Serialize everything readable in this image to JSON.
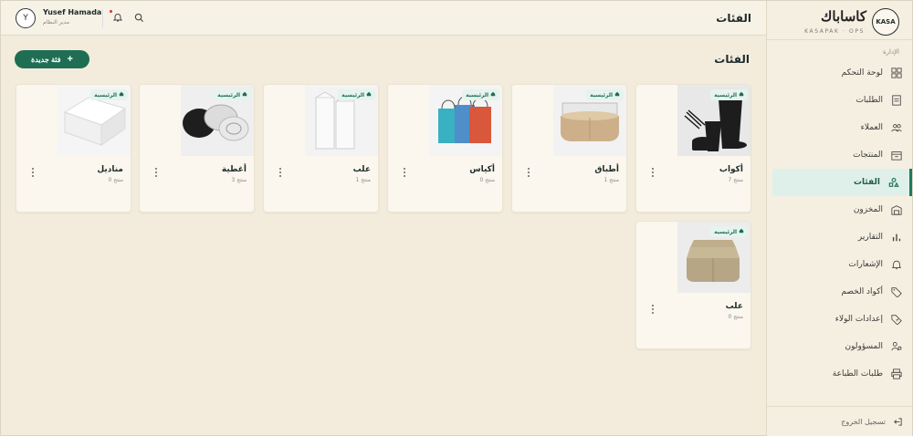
{
  "header": {
    "title": "الفئات",
    "user_name": "Yusef Hamada",
    "user_role": "مدير النظام",
    "avatar_initial": "Y"
  },
  "brand": {
    "badge": "KASA",
    "name_ar": "كاساباك",
    "name_en": "KASAPAK · OPS"
  },
  "sidebar": {
    "section_label": "الإدارة",
    "items": [
      {
        "label": "لوحة التحكم",
        "icon": "dashboard-icon"
      },
      {
        "label": "الطلبات",
        "icon": "orders-icon"
      },
      {
        "label": "العملاء",
        "icon": "customers-icon"
      },
      {
        "label": "المنتجات",
        "icon": "products-icon"
      },
      {
        "label": "الفئات",
        "icon": "categories-icon"
      },
      {
        "label": "المخزون",
        "icon": "warehouse-icon"
      },
      {
        "label": "التقارير",
        "icon": "reports-icon"
      },
      {
        "label": "الإشعارات",
        "icon": "bell-icon"
      },
      {
        "label": "أكواد الخصم",
        "icon": "tag-icon"
      },
      {
        "label": "إعدادات الولاء",
        "icon": "loyalty-icon"
      },
      {
        "label": "المسؤولون",
        "icon": "admins-icon"
      },
      {
        "label": "طلبات الطباعة",
        "icon": "printer-icon"
      }
    ],
    "active_index": 4,
    "logout_label": "تسجيل الخروج"
  },
  "main": {
    "title": "الفئات",
    "new_button": "فئة جديدة",
    "badge_label": "الرئيسية",
    "cards": [
      {
        "name": "أكواب",
        "count": "7 منتج",
        "image": "cups"
      },
      {
        "name": "أطباق",
        "count": "1 منتج",
        "image": "plates"
      },
      {
        "name": "أكياس",
        "count": "0 منتج",
        "image": "bags"
      },
      {
        "name": "علب",
        "count": "1 منتج",
        "image": "cartons"
      },
      {
        "name": "أغطية",
        "count": "3 منتج",
        "image": "lids"
      },
      {
        "name": "مناديل",
        "count": "0 منتج",
        "image": "napkins"
      },
      {
        "name": "علب",
        "count": "0 منتج",
        "image": "boxes"
      }
    ]
  },
  "colors": {
    "accent": "#1f6e54",
    "background": "#f3ecdc",
    "card": "#fbf7ee",
    "notification_dot": "#d4313b"
  }
}
